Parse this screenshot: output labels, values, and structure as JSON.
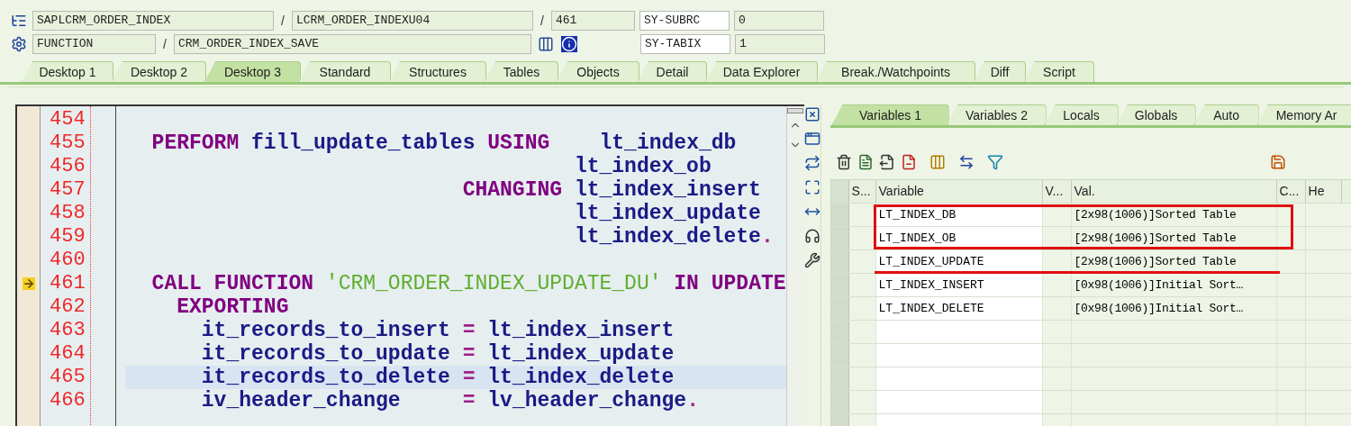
{
  "header": {
    "program": "SAPLCRM_ORDER_INDEX",
    "include": "LCRM_ORDER_INDEXU04",
    "line": "461",
    "event_type": "FUNCTION",
    "event": "CRM_ORDER_INDEX_SAVE",
    "separators": [
      "/",
      "/",
      "/"
    ],
    "system_fields": [
      {
        "name": "SY-SUBRC",
        "value": "0"
      },
      {
        "name": "SY-TABIX",
        "value": "1"
      }
    ]
  },
  "desktop_tabs": [
    {
      "label": "Desktop 1",
      "selected": false
    },
    {
      "label": "Desktop 2",
      "selected": false
    },
    {
      "label": "Desktop 3",
      "selected": true
    },
    {
      "label": "Standard",
      "selected": false
    },
    {
      "label": "Structures",
      "selected": false
    },
    {
      "label": "Tables",
      "selected": false
    },
    {
      "label": "Objects",
      "selected": false
    },
    {
      "label": "Detail",
      "selected": false
    },
    {
      "label": "Data Explorer",
      "selected": false
    },
    {
      "label": "Break./Watchpoints",
      "selected": false
    },
    {
      "label": "Diff",
      "selected": false
    },
    {
      "label": "Script",
      "selected": false
    }
  ],
  "source": {
    "lines": [
      {
        "number": "454",
        "current": false,
        "highlighted": false
      },
      {
        "number": "455",
        "current": false,
        "highlighted": false,
        "tokens": [
          {
            "kind": "keyword",
            "text": "  PERFORM "
          },
          {
            "kind": "ident",
            "text": "fill_update_tables "
          },
          {
            "kind": "keyword",
            "text": "USING    "
          },
          {
            "kind": "ident",
            "text": "lt_index_db"
          }
        ]
      },
      {
        "number": "456",
        "current": false,
        "highlighted": false,
        "tokens": [
          {
            "kind": "ident",
            "text": "                                    lt_index_ob"
          }
        ]
      },
      {
        "number": "457",
        "current": false,
        "highlighted": false,
        "tokens": [
          {
            "kind": "keyword",
            "text": "                           CHANGING "
          },
          {
            "kind": "ident",
            "text": "lt_index_insert"
          }
        ]
      },
      {
        "number": "458",
        "current": false,
        "highlighted": false,
        "tokens": [
          {
            "kind": "ident",
            "text": "                                    lt_index_update"
          }
        ]
      },
      {
        "number": "459",
        "current": false,
        "highlighted": false,
        "tokens": [
          {
            "kind": "ident",
            "text": "                                    lt_index_delete"
          },
          {
            "kind": "op",
            "text": "."
          }
        ]
      },
      {
        "number": "460",
        "current": false,
        "highlighted": false
      },
      {
        "number": "461",
        "current": true,
        "highlighted": false,
        "tokens": [
          {
            "kind": "keyword",
            "text": "  CALL FUNCTION "
          },
          {
            "kind": "string",
            "text": "'CRM_ORDER_INDEX_UPDATE_DU' "
          },
          {
            "kind": "keyword",
            "text": "IN UPDATE"
          }
        ]
      },
      {
        "number": "462",
        "current": false,
        "highlighted": false,
        "tokens": [
          {
            "kind": "keyword",
            "text": "    EXPORTING"
          }
        ]
      },
      {
        "number": "463",
        "current": false,
        "highlighted": false,
        "tokens": [
          {
            "kind": "ident",
            "text": "      it_records_to_insert "
          },
          {
            "kind": "op",
            "text": "= "
          },
          {
            "kind": "ident",
            "text": "lt_index_insert"
          }
        ]
      },
      {
        "number": "464",
        "current": false,
        "highlighted": false,
        "tokens": [
          {
            "kind": "ident",
            "text": "      it_records_to_update "
          },
          {
            "kind": "op",
            "text": "= "
          },
          {
            "kind": "ident",
            "text": "lt_index_update"
          }
        ]
      },
      {
        "number": "465",
        "current": false,
        "highlighted": true,
        "tokens": [
          {
            "kind": "ident",
            "text": "      it_records_to_delete "
          },
          {
            "kind": "op",
            "text": "= "
          },
          {
            "kind": "ident",
            "text": "lt_index_delete"
          }
        ]
      },
      {
        "number": "466",
        "current": false,
        "highlighted": false,
        "tokens": [
          {
            "kind": "ident",
            "text": "      iv_header_change     "
          },
          {
            "kind": "op",
            "text": "= "
          },
          {
            "kind": "ident",
            "text": "lv_header_change"
          },
          {
            "kind": "op",
            "text": "."
          }
        ]
      }
    ]
  },
  "variable_tabs": [
    {
      "label": "Variables 1",
      "selected": true
    },
    {
      "label": "Variables 2",
      "selected": false
    },
    {
      "label": "Locals",
      "selected": false
    },
    {
      "label": "Globals",
      "selected": false
    },
    {
      "label": "Auto",
      "selected": false
    },
    {
      "label": "Memory Ar",
      "selected": false
    }
  ],
  "variables_table": {
    "columns": [
      "S...",
      "Variable",
      "V...",
      "Val.",
      "C...",
      "He"
    ],
    "rows": [
      {
        "variable": "LT_INDEX_DB",
        "value": "[2x98(1006)]Sorted Table"
      },
      {
        "variable": "LT_INDEX_OB",
        "value": "[2x98(1006)]Sorted Table"
      },
      {
        "variable": "LT_INDEX_UPDATE",
        "value": "[2x98(1006)]Sorted Table"
      },
      {
        "variable": "LT_INDEX_INSERT",
        "value": "[0x98(1006)]Initial Sort…"
      },
      {
        "variable": "LT_INDEX_DELETE",
        "value": "[0x98(1006)]Initial Sort…"
      }
    ]
  }
}
